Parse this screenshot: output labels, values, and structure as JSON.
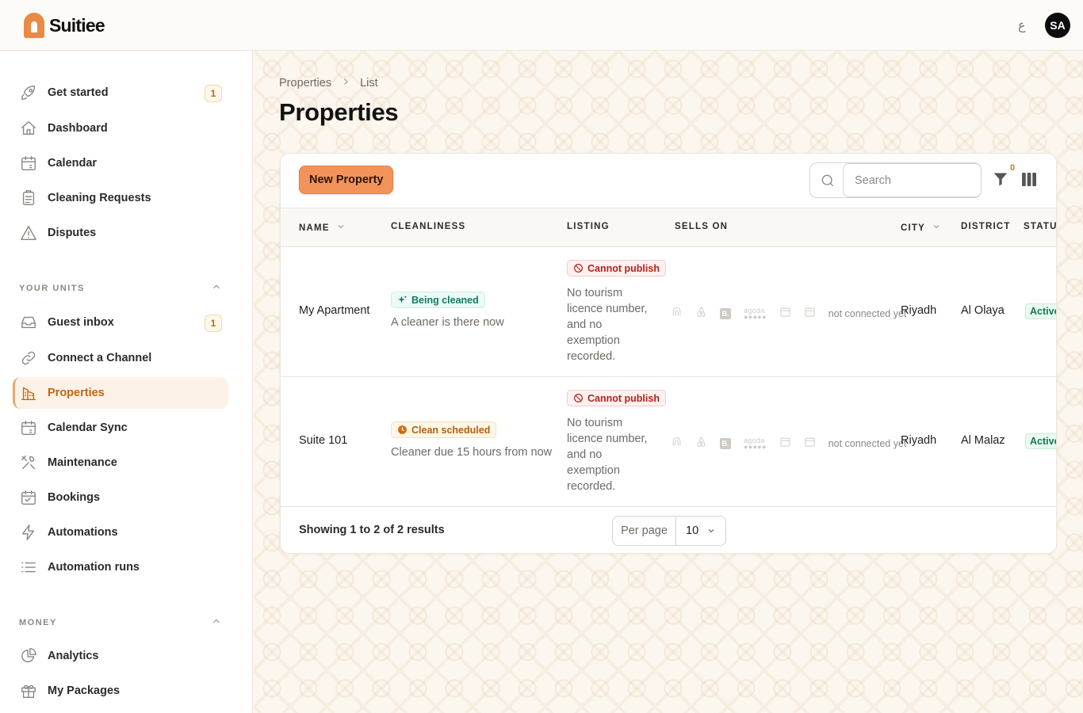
{
  "app": {
    "name": "Suitiee",
    "lang_toggle": "ع",
    "user_initials": "SA"
  },
  "sidebar": {
    "items_top": [
      {
        "label": "Get started",
        "icon": "rocket-icon",
        "badge": "1"
      },
      {
        "label": "Dashboard",
        "icon": "home-icon"
      },
      {
        "label": "Calendar",
        "icon": "calendar-icon"
      },
      {
        "label": "Cleaning Requests",
        "icon": "clipboard-icon"
      },
      {
        "label": "Disputes",
        "icon": "warning-icon"
      }
    ],
    "section_units": "YOUR UNITS",
    "items_units": [
      {
        "label": "Guest inbox",
        "icon": "inbox-icon",
        "badge": "1"
      },
      {
        "label": "Connect a Channel",
        "icon": "link-icon"
      },
      {
        "label": "Properties",
        "icon": "building-icon",
        "active": true
      },
      {
        "label": "Calendar Sync",
        "icon": "calendar-sync-icon"
      },
      {
        "label": "Maintenance",
        "icon": "tools-icon"
      },
      {
        "label": "Bookings",
        "icon": "bookings-icon"
      },
      {
        "label": "Automations",
        "icon": "bolt-icon"
      },
      {
        "label": "Automation runs",
        "icon": "list-icon"
      }
    ],
    "section_money": "MONEY",
    "items_money": [
      {
        "label": "Analytics",
        "icon": "pie-chart-icon"
      },
      {
        "label": "My Packages",
        "icon": "gift-icon"
      }
    ]
  },
  "breadcrumb": {
    "root": "Properties",
    "current": "List"
  },
  "page_title": "Properties",
  "toolbar": {
    "new_property": "New Property",
    "search_placeholder": "Search",
    "filter_count": "0"
  },
  "table": {
    "columns": {
      "name": "NAME",
      "cleanliness": "CLEANLINESS",
      "listing": "LISTING",
      "sells_on": "SELLS ON",
      "city": "CITY",
      "district": "DISTRICT",
      "status": "STATUS"
    },
    "rows": [
      {
        "name": "My Apartment",
        "clean_chip": "Being cleaned",
        "clean_sub": "A cleaner is there now",
        "listing_chip": "Cannot publish",
        "listing_note": "No tourism licence number, and no exemption recorded.",
        "channels_note": "not connected yet",
        "city": "Riyadh",
        "district": "Al Olaya",
        "status": "Active"
      },
      {
        "name": "Suite 101",
        "clean_chip": "Clean scheduled",
        "clean_sub": "Cleaner due 15 hours from now",
        "listing_chip": "Cannot publish",
        "listing_note": "No tourism licence number, and no exemption recorded.",
        "channels_note": "not connected yet",
        "city": "Riyadh",
        "district": "Al Malaz",
        "status": "Active"
      }
    ],
    "channel_icons": [
      "airbnb-icon",
      "airbnb-alt-icon",
      "booking-icon",
      "agoda-icon",
      "calendar-icon",
      "calendar-icon"
    ],
    "channel_labels": {
      "booking": "B.",
      "agoda": "agoda"
    }
  },
  "footer": {
    "showing": "Showing 1 to 2 of 2 results",
    "per_page_label": "Per page",
    "per_page_value": "10"
  },
  "colors": {
    "accent": "#f2935a",
    "active_nav": "#c0660f",
    "status_active": "#127a4f"
  }
}
